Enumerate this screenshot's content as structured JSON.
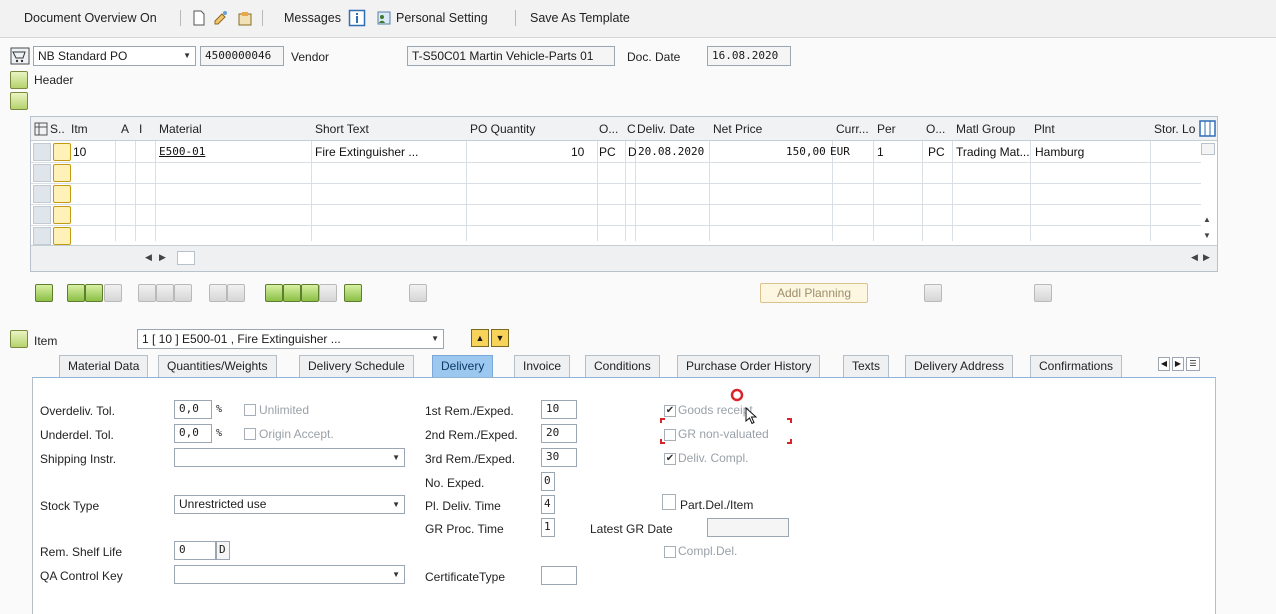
{
  "toolbar": {
    "document_overview": "Document Overview On",
    "messages": "Messages",
    "personal_setting": "Personal Setting",
    "save_as_template": "Save As Template"
  },
  "header": {
    "doc_type": "NB Standard PO",
    "po_number": "4500000046",
    "vendor_label": "Vendor",
    "vendor_value": "T-S50C01 Martin Vehicle-Parts 01",
    "doc_date_label": "Doc. Date",
    "doc_date_value": "16.08.2020",
    "header_label": "Header"
  },
  "grid": {
    "columns": [
      "S..",
      "Itm",
      "A",
      "I",
      "Material",
      "Short Text",
      "PO Quantity",
      "O...",
      "C",
      "Deliv. Date",
      "Net Price",
      "Curr...",
      "Per",
      "O...",
      "Matl Group",
      "Plnt",
      "Stor. Lo"
    ],
    "row": {
      "itm": "10",
      "material": "E500-01",
      "short_text": "Fire Extinguisher ...",
      "po_quantity": "10",
      "order_unit": "PC",
      "c": "D",
      "deliv_date": "20.08.2020",
      "net_price": "150,00",
      "currency": "EUR",
      "per": "1",
      "order_price_unit": "PC",
      "matl_group": "Trading Mat...",
      "plant": "Hamburg"
    }
  },
  "addl_planning": "Addl Planning",
  "item": {
    "label": "Item",
    "selected": "1 [ 10 ] E500-01 , Fire Extinguisher ..."
  },
  "tabs": [
    "Material Data",
    "Quantities/Weights",
    "Delivery Schedule",
    "Delivery",
    "Invoice",
    "Conditions",
    "Purchase Order History",
    "Texts",
    "Delivery Address",
    "Confirmations"
  ],
  "delivery": {
    "overdeliv_label": "Overdeliv. Tol.",
    "overdeliv_value": "0,0",
    "unlimited_label": "Unlimited",
    "underdel_label": "Underdel. Tol.",
    "underdel_value": "0,0",
    "origin_accept_label": "Origin Accept.",
    "percent": "%",
    "shipping_instr_label": "Shipping Instr.",
    "stock_type_label": "Stock Type",
    "stock_type_value": "Unrestricted use",
    "rem_shelf_life_label": "Rem. Shelf Life",
    "rem_shelf_life_value": "0",
    "rem_shelf_life_unit": "D",
    "qa_control_key_label": "QA Control Key",
    "rem1_label": "1st Rem./Exped.",
    "rem1_value": "10",
    "rem2_label": "2nd Rem./Exped.",
    "rem2_value": "20",
    "rem3_label": "3rd Rem./Exped.",
    "rem3_value": "30",
    "no_exped_label": "No. Exped.",
    "no_exped_value": "0",
    "pl_deliv_time_label": "Pl. Deliv. Time",
    "pl_deliv_time_value": "4",
    "gr_proc_time_label": "GR Proc. Time",
    "gr_proc_time_value": "1",
    "certificate_type_label": "CertificateType",
    "goods_receipt_label": "Goods receipt",
    "gr_non_valuated_label": "GR non-valuated",
    "deliv_compl_label": "Deliv. Compl.",
    "part_del_item_label": "Part.Del./Item",
    "latest_gr_date_label": "Latest GR Date",
    "compl_del_label": "Compl.Del."
  }
}
